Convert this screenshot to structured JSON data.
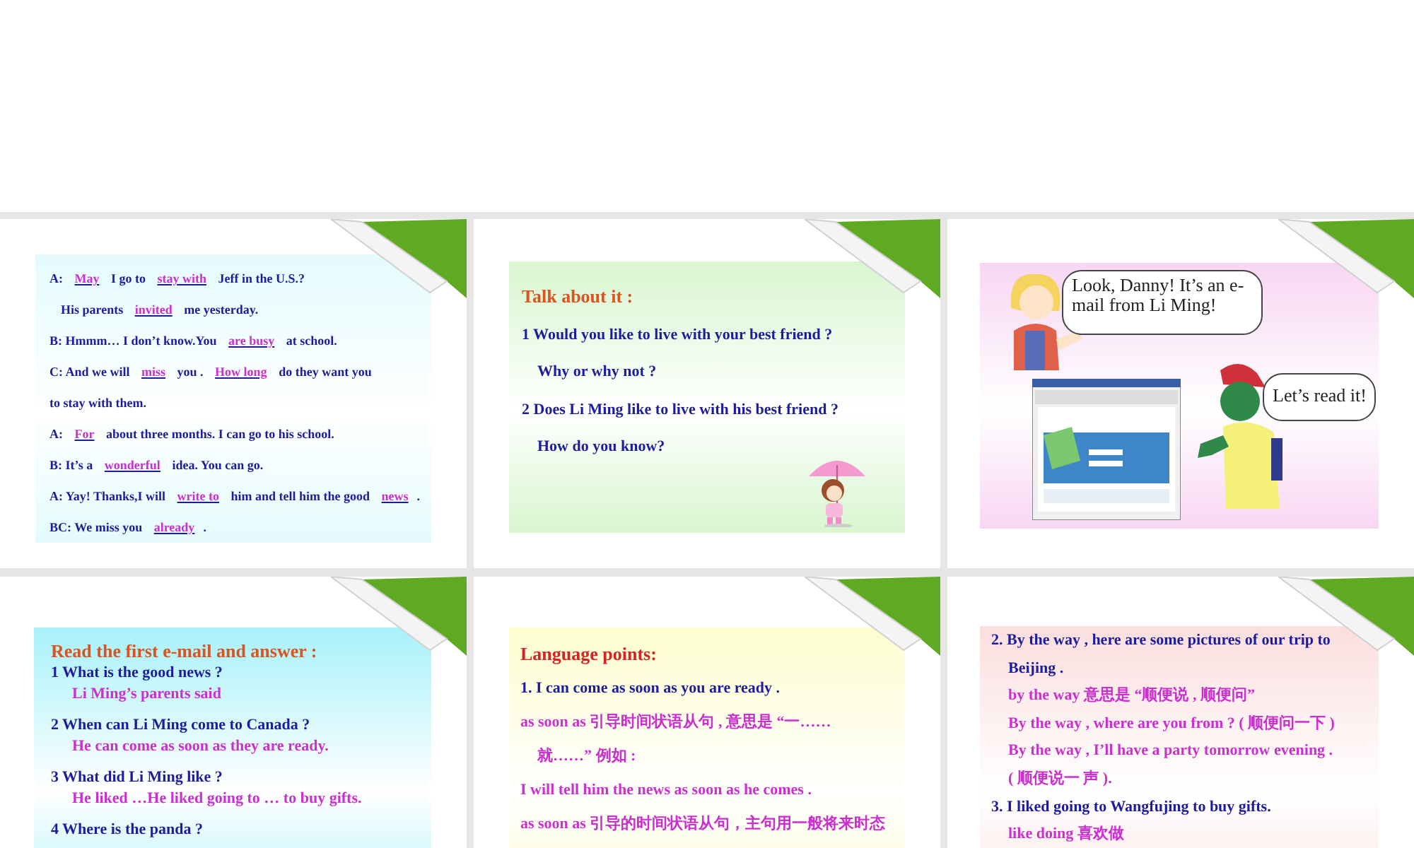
{
  "slides": [
    {
      "kind": "text",
      "color": "#e4fbfd",
      "lines": [
        {
          "kind": "plain",
          "indented": false,
          "parts": [
            {
              "kind": "text",
              "text": "A: "
            },
            {
              "kind": "blank",
              "text": "May"
            },
            {
              "kind": "text",
              "text": " I go to "
            },
            {
              "kind": "blank",
              "text": "stay  with"
            },
            {
              "kind": "text",
              "text": " Jeff in the U.S.?"
            }
          ]
        },
        {
          "kind": "plain",
          "indented": true,
          "parts": [
            {
              "kind": "text",
              "text": "His  parents "
            },
            {
              "kind": "blank",
              "text": "invited"
            },
            {
              "kind": "text",
              "text": " me yesterday."
            }
          ]
        },
        {
          "kind": "plain",
          "indented": false,
          "parts": [
            {
              "kind": "text",
              "text": "B: Hmmm… I don’t know.You "
            },
            {
              "kind": "blank",
              "text": "are  busy"
            },
            {
              "kind": "text",
              "text": " at school."
            }
          ]
        },
        {
          "kind": "plain",
          "indented": false,
          "parts": [
            {
              "kind": "text",
              "text": "C: And we will "
            },
            {
              "kind": "blank",
              "text": "miss"
            },
            {
              "kind": "text",
              "text": " you . "
            },
            {
              "kind": "blank",
              "text": "How long"
            },
            {
              "kind": "text",
              "text": " do they want you"
            }
          ]
        },
        {
          "kind": "plain",
          "indented": false,
          "parts": [
            {
              "kind": "text",
              "text": " to stay with them."
            }
          ]
        },
        {
          "kind": "plain",
          "indented": false,
          "parts": [
            {
              "kind": "text",
              "text": "A: "
            },
            {
              "kind": "blank",
              "text": "For"
            },
            {
              "kind": "text",
              "text": " about three months. I can go to his school."
            }
          ]
        },
        {
          "kind": "plain",
          "indented": false,
          "parts": [
            {
              "kind": "text",
              "text": "B: It’s a "
            },
            {
              "kind": "blank",
              "text": "wonderful"
            },
            {
              "kind": "text",
              "text": " idea. You can go."
            }
          ]
        },
        {
          "kind": "plain",
          "indented": false,
          "parts": [
            {
              "kind": "text",
              "text": "A: Yay! Thanks,I will "
            },
            {
              "kind": "blank",
              "text": "write to"
            },
            {
              "kind": "text",
              "text": " him and tell him the good "
            },
            {
              "kind": "blank",
              "text": "news"
            },
            {
              "kind": "text",
              "text": "."
            }
          ]
        },
        {
          "kind": "plain",
          "indented": false,
          "parts": [
            {
              "kind": "text",
              "text": "BC: We miss you "
            },
            {
              "kind": "blank",
              "text": "already"
            },
            {
              "kind": "text",
              "text": "."
            }
          ]
        }
      ]
    },
    {
      "kind": "talk",
      "color": "#d8f6cf",
      "lines": [
        {
          "kind": "heading",
          "indented": false,
          "text": "Talk about it  :"
        },
        {
          "kind": "question",
          "indented": false,
          "text": "1  Would you like to live with your best friend ?"
        },
        {
          "kind": "question",
          "indented": true,
          "text": "Why or why not ?"
        },
        {
          "kind": "question",
          "indented": false,
          "text": "2  Does Li Ming like to live with his best friend ?"
        },
        {
          "kind": "question",
          "indented": true,
          "text": "How do you know?"
        }
      ]
    },
    {
      "kind": "scene",
      "color": "#f8d6f3",
      "bubbles": [
        {
          "text": "Look, Danny! It’s an e-mail from Li Ming!"
        },
        {
          "text": "Let’s read it!"
        }
      ]
    },
    {
      "kind": "qa",
      "color": "#a8f1fa",
      "lines": [
        {
          "kind": "heading",
          "indented": false,
          "text": "Read the first e-mail and answer :"
        },
        {
          "kind": "question",
          "indented": false,
          "text": "1   What is the good news ?"
        },
        {
          "kind": "answer",
          "indented": true,
          "text": "Li Ming’s  parents  said"
        },
        {
          "kind": "question",
          "indented": false,
          "text": "2   When can Li Ming come to Canada ?"
        },
        {
          "kind": "answer",
          "indented": true,
          "text": "He can come as soon as they are ready."
        },
        {
          "kind": "question",
          "indented": false,
          "text": "3   What did Li Ming like ?"
        },
        {
          "kind": "answer",
          "indented": true,
          "text": "He liked …He liked going to … to buy gifts."
        },
        {
          "kind": "question",
          "indented": false,
          "text": "4   Where is the panda ?"
        }
      ]
    },
    {
      "kind": "notes",
      "color": "#fdfdcf",
      "lines": [
        {
          "kind": "heading",
          "indented": false,
          "text": "Language points:"
        },
        {
          "kind": "question",
          "indented": false,
          "text": "1.  I can come as soon as you are ready ."
        },
        {
          "kind": "answer",
          "indented": false,
          "text": " as soon as  引导时间状语从句 , 意思是  “一……"
        },
        {
          "kind": "answer",
          "indented": true,
          "text": "就……” 例如 :"
        },
        {
          "kind": "answer",
          "indented": false,
          "text": "I will tell him the news as soon as he comes ."
        },
        {
          "kind": "answer",
          "indented": false,
          "text": "as soon as  引导的时间状语从句，主句用一般将来时态"
        }
      ]
    },
    {
      "kind": "points",
      "color": "#fbdede",
      "lines": [
        {
          "kind": "question",
          "indented": false,
          "text": "2. By the way , here are some pictures of our trip to"
        },
        {
          "kind": "question",
          "indented": true,
          "text": "Beijing ."
        },
        {
          "kind": "answer",
          "indented": true,
          "text": "by the way  意思是  “顺便说 , 顺便问”"
        },
        {
          "kind": "answer",
          "indented": true,
          "text": "By the way , where are you from ?  ( 顺便问一下 )"
        },
        {
          "kind": "answer",
          "indented": true,
          "text": "By the way , I’ll have a party tomorrow evening ."
        },
        {
          "kind": "answer",
          "indented": true,
          "text": "( 顺便说一  声 )."
        },
        {
          "kind": "question",
          "indented": false,
          "text": "3.  I liked going to Wangfujing to buy gifts."
        },
        {
          "kind": "answer",
          "indented": true,
          "text": "like   doing    喜欢做"
        }
      ]
    }
  ]
}
